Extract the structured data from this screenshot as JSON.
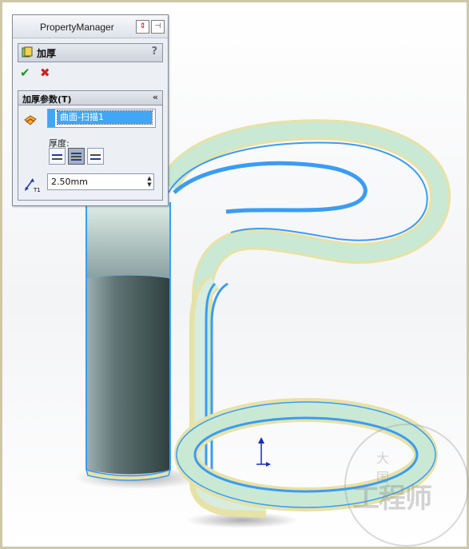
{
  "property_manager": {
    "title": "PropertyManager",
    "feature_title": "加厚",
    "help_label": "?",
    "ok_symbol": "✔",
    "cancel_symbol": "✖",
    "group": {
      "title": "加厚参数(T)",
      "selected_face": "曲面-扫描1",
      "thickness_label": "厚度:",
      "thickness_value": "2.50mm",
      "active_side": 1
    }
  },
  "watermark": {
    "top_text": "大  国",
    "main_text": "工程师"
  },
  "colors": {
    "accent": "#3fa7f5",
    "model_edge": "#3b9cf2",
    "model_face": "#c9e9d4",
    "thick_layer": "#e7e2a6"
  }
}
